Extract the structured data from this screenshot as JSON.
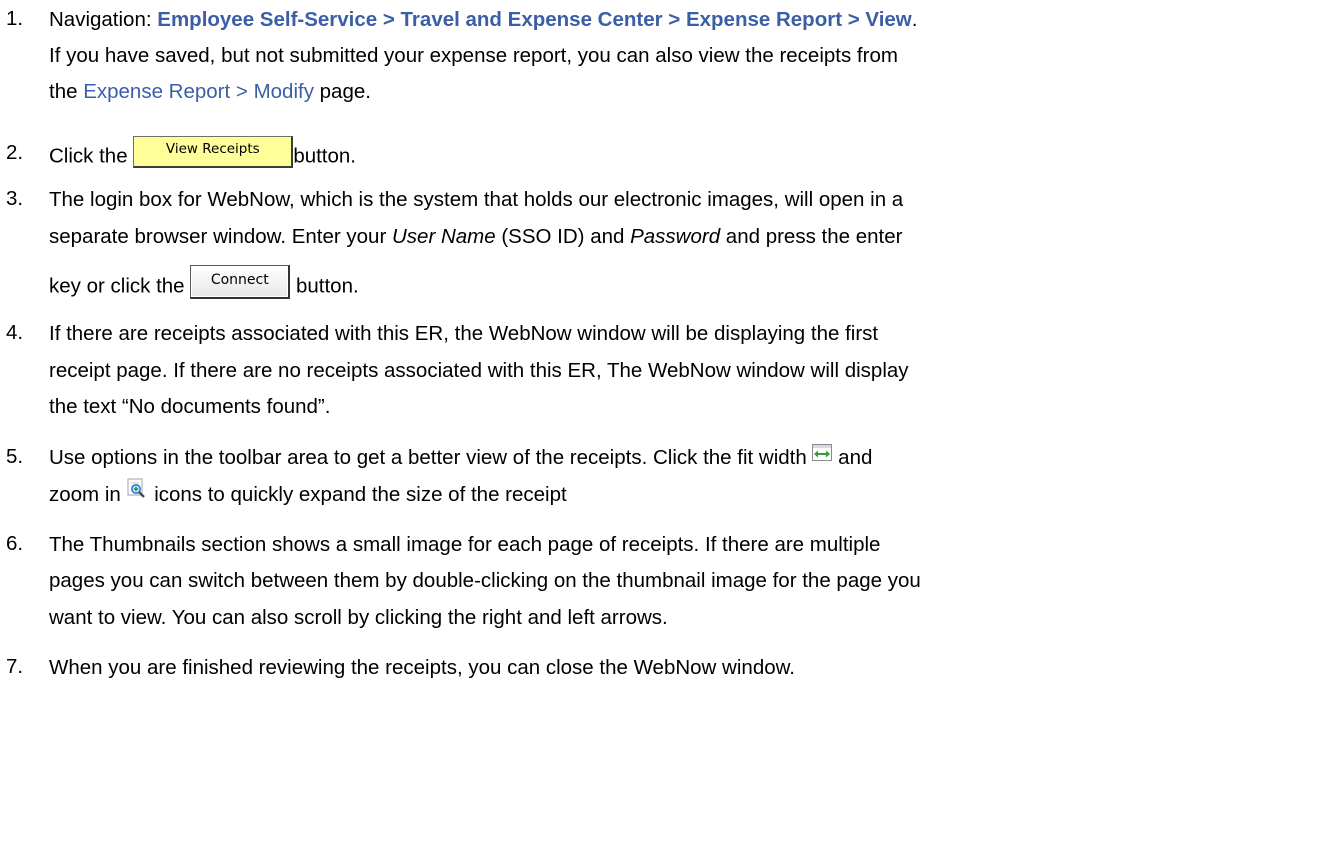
{
  "steps": [
    {
      "number": "1.",
      "nav_label": "Navigation:",
      "nav_path": "Employee Self-Service > Travel and Expense Center > Expense Report > View",
      "nav_period": ".",
      "line2": "If you have saved, but not submitted your expense report, you can also view the receipts from",
      "line3_pre": "the ",
      "line3_link": "Expense Report > Modify",
      "line3_post": " page."
    },
    {
      "number": "2.",
      "pre": "Click the",
      "button_label": "View Receipts",
      "post": "button."
    },
    {
      "number": "3.",
      "line1": "The login box for WebNow, which is the system that holds our electronic images, will open in a",
      "line2_a": "separate browser window. Enter your ",
      "line2_user": "User Name",
      "line2_b": " (SSO ID) and ",
      "line2_pass": "Password",
      "line2_c": " and press the enter",
      "line3_pre": "key or click the",
      "button_label": "Connect",
      "line3_post": "button."
    },
    {
      "number": "4.",
      "line1": "If there are receipts associated with this ER, the WebNow window will be displaying the first",
      "line2": "receipt page.  If there are no receipts associated with this ER, The WebNow window will display",
      "line3": "the text “No documents found”."
    },
    {
      "number": "5.",
      "line1_pre": "Use options in the toolbar area to get a better view of the receipts.  Click the fit width",
      "line1_post": "and",
      "line2_pre": "zoom in",
      "line2_post": "icons to quickly expand the size of the receipt"
    },
    {
      "number": "6.",
      "line1": "The Thumbnails section shows a small image for each page of receipts.  If there are multiple",
      "line2": "pages you can switch between them by double-clicking on the thumbnail image for the page you",
      "line3": "want to view. You can also scroll by clicking the right and left arrows."
    },
    {
      "number": "7.",
      "line1": "When you are finished reviewing the receipts, you can close the WebNow window."
    }
  ],
  "colors": {
    "link": "#3c5ea6",
    "view_button": "#ffff99",
    "fit_width_icon": "#4caf50",
    "zoom_icon": "#2e7bd6"
  },
  "icons": [
    "fit-width-icon",
    "zoom-in-icon"
  ]
}
